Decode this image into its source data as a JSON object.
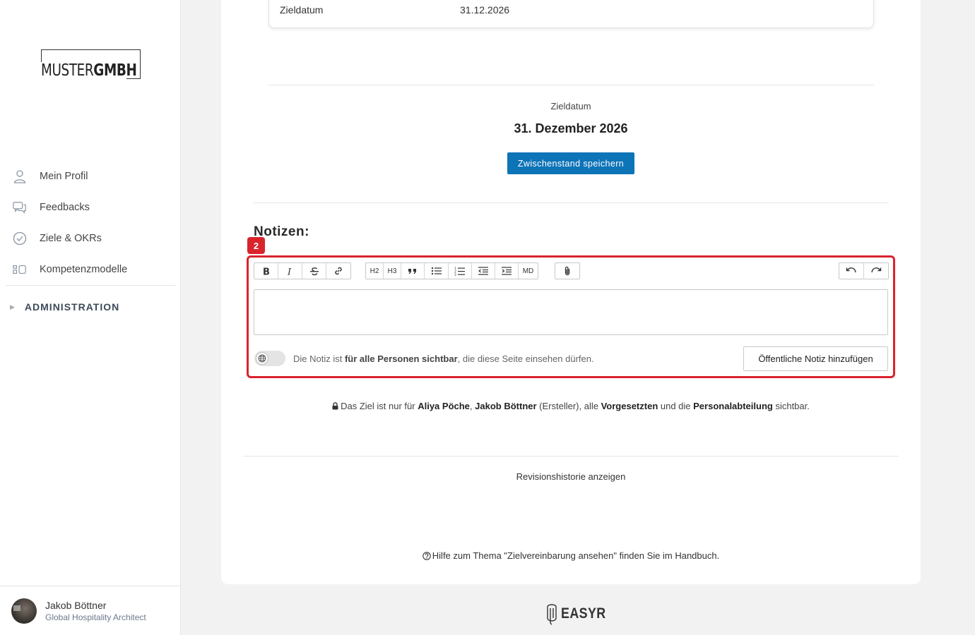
{
  "sidebar": {
    "logo": {
      "part1": "MUSTER",
      "part2": "GMBH"
    },
    "nav": [
      {
        "label": "Mein Profil",
        "icon": "user-icon"
      },
      {
        "label": "Feedbacks",
        "icon": "chat-icon"
      },
      {
        "label": "Ziele & OKRs",
        "icon": "check-circle-icon"
      },
      {
        "label": "Kompetenzmodelle",
        "icon": "grid-icon"
      }
    ],
    "admin_label": "ADMINISTRATION",
    "user": {
      "name": "Jakob Böttner",
      "role": "Global Hospitality Architect"
    }
  },
  "goal": {
    "detail_key": "Zieldatum",
    "detail_value": "31.12.2026",
    "date_label": "Zieldatum",
    "date_value": "31. Dezember 2026",
    "save_button": "Zwischenstand speichern"
  },
  "notes": {
    "title": "Notizen:",
    "badge": "2",
    "toolbar": {
      "h2": "H2",
      "h3": "H3",
      "md": "MD"
    },
    "editor_value": "",
    "visibility": {
      "prefix": "Die Notiz ist ",
      "bold": "für alle Personen sichtbar",
      "suffix": ", die diese Seite einsehen dürfen."
    },
    "add_button": "Öffentliche Notiz hinzufügen"
  },
  "privacy": {
    "t1": "Das Ziel ist nur für ",
    "p1": "Aliya Pöche",
    "t2": ", ",
    "p2": "Jakob Böttner",
    "t3": " (Ersteller), alle ",
    "p3": "Vorgesetzten",
    "t4": " und die ",
    "p4": "Personalabteilung",
    "t5": " sichtbar."
  },
  "revision_link": "Revisionshistorie anzeigen",
  "help_text": "Hilfe zum Thema \"Zielvereinbarung ansehen\" finden Sie im Handbuch.",
  "footer": {
    "brand": "EASYR"
  },
  "colors": {
    "accent": "#0e74b8",
    "highlight": "#d9232d"
  }
}
